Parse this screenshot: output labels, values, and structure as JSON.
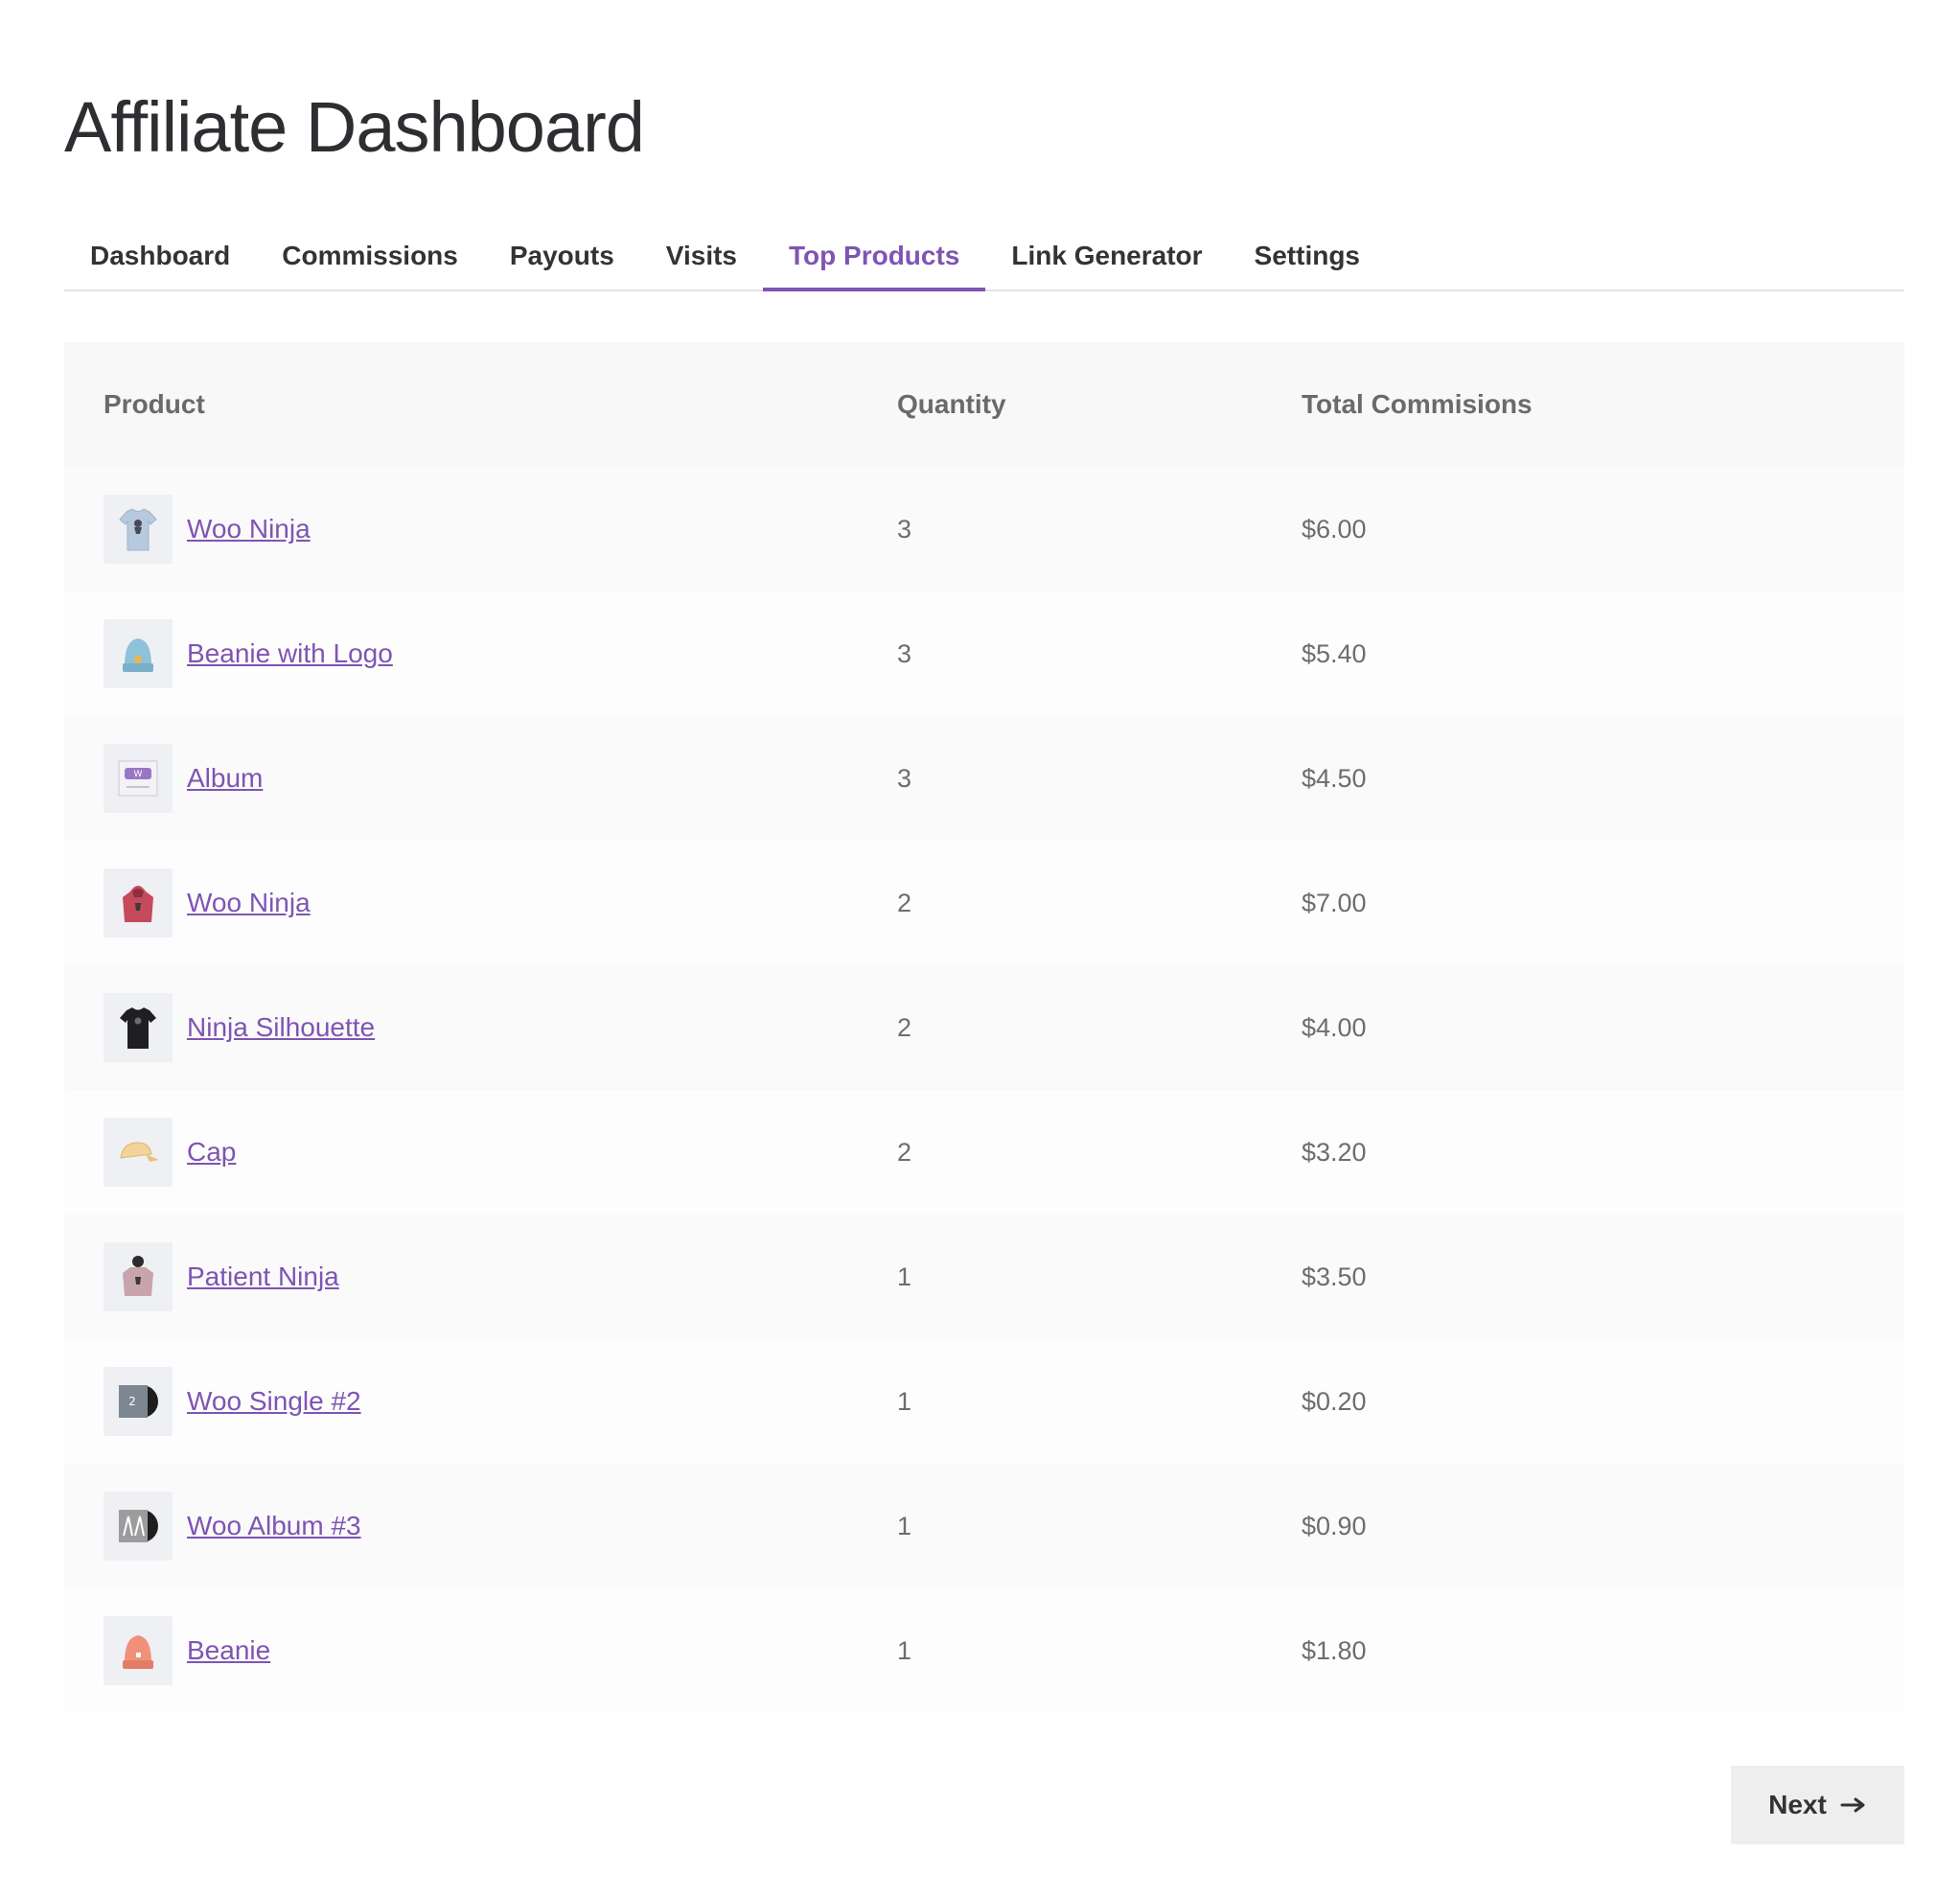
{
  "page_title": "Affiliate Dashboard",
  "tabs": [
    {
      "label": "Dashboard",
      "active": false
    },
    {
      "label": "Commissions",
      "active": false
    },
    {
      "label": "Payouts",
      "active": false
    },
    {
      "label": "Visits",
      "active": false
    },
    {
      "label": "Top Products",
      "active": true
    },
    {
      "label": "Link Generator",
      "active": false
    },
    {
      "label": "Settings",
      "active": false
    }
  ],
  "accent_color": "#7f54b3",
  "table": {
    "headers": {
      "product": "Product",
      "quantity": "Quantity",
      "total": "Total Commisions"
    },
    "rows": [
      {
        "product": "Woo Ninja",
        "quantity": "3",
        "total": "$6.00",
        "icon": "tshirt-light-blue-icon"
      },
      {
        "product": "Beanie with Logo",
        "quantity": "3",
        "total": "$5.40",
        "icon": "beanie-blue-icon"
      },
      {
        "product": "Album",
        "quantity": "3",
        "total": "$4.50",
        "icon": "album-woo-icon"
      },
      {
        "product": "Woo Ninja",
        "quantity": "2",
        "total": "$7.00",
        "icon": "hoodie-red-icon"
      },
      {
        "product": "Ninja Silhouette",
        "quantity": "2",
        "total": "$4.00",
        "icon": "tshirt-black-icon"
      },
      {
        "product": "Cap",
        "quantity": "2",
        "total": "$3.20",
        "icon": "cap-yellow-icon"
      },
      {
        "product": "Patient Ninja",
        "quantity": "1",
        "total": "$3.50",
        "icon": "hoodie-pink-icon"
      },
      {
        "product": "Woo Single #2",
        "quantity": "1",
        "total": "$0.20",
        "icon": "vinyl-single-icon"
      },
      {
        "product": "Woo Album #3",
        "quantity": "1",
        "total": "$0.90",
        "icon": "vinyl-album-icon"
      },
      {
        "product": "Beanie",
        "quantity": "1",
        "total": "$1.80",
        "icon": "beanie-orange-icon"
      }
    ]
  },
  "pagination": {
    "next_label": "Next"
  }
}
